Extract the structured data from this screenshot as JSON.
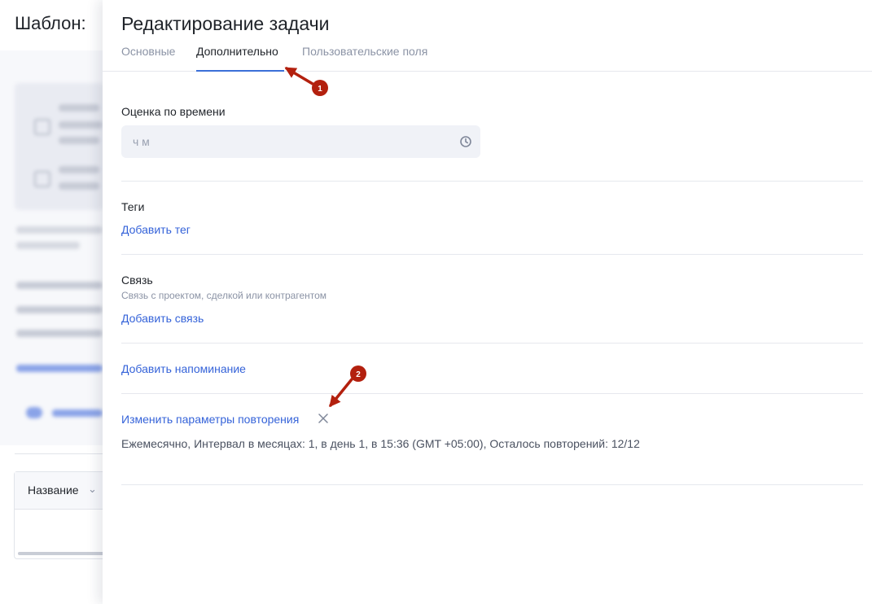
{
  "background": {
    "page_title": "Шаблон:",
    "table_header": "Название"
  },
  "drawer": {
    "title": "Редактирование задачи",
    "tabs": [
      {
        "label": "Основные",
        "active": false
      },
      {
        "label": "Дополнительно",
        "active": true
      },
      {
        "label": "Пользовательские поля",
        "active": false
      }
    ],
    "time_estimate": {
      "label": "Оценка по времени",
      "placeholder": "ч м"
    },
    "tags": {
      "label": "Теги",
      "add_link": "Добавить тег"
    },
    "link": {
      "label": "Связь",
      "hint": "Связь с проектом, сделкой или контрагентом",
      "add_link": "Добавить связь"
    },
    "reminder": {
      "add_link": "Добавить напоминание"
    },
    "repeat": {
      "edit_link": "Изменить параметры повторения",
      "summary": "Ежемесячно, Интервал в месяцах: 1, в день 1, в 15:36 (GMT +05:00), Осталось повторений: 12/12"
    }
  },
  "annotations": [
    {
      "number": "1"
    },
    {
      "number": "2"
    }
  ],
  "colors": {
    "accent": "#3563d9",
    "tab_underline": "#3b6fd8",
    "annotation": "#b3200e"
  },
  "icons": {
    "clock": "clock-icon",
    "close": "close-icon",
    "chevron": "chevron-down-icon"
  }
}
